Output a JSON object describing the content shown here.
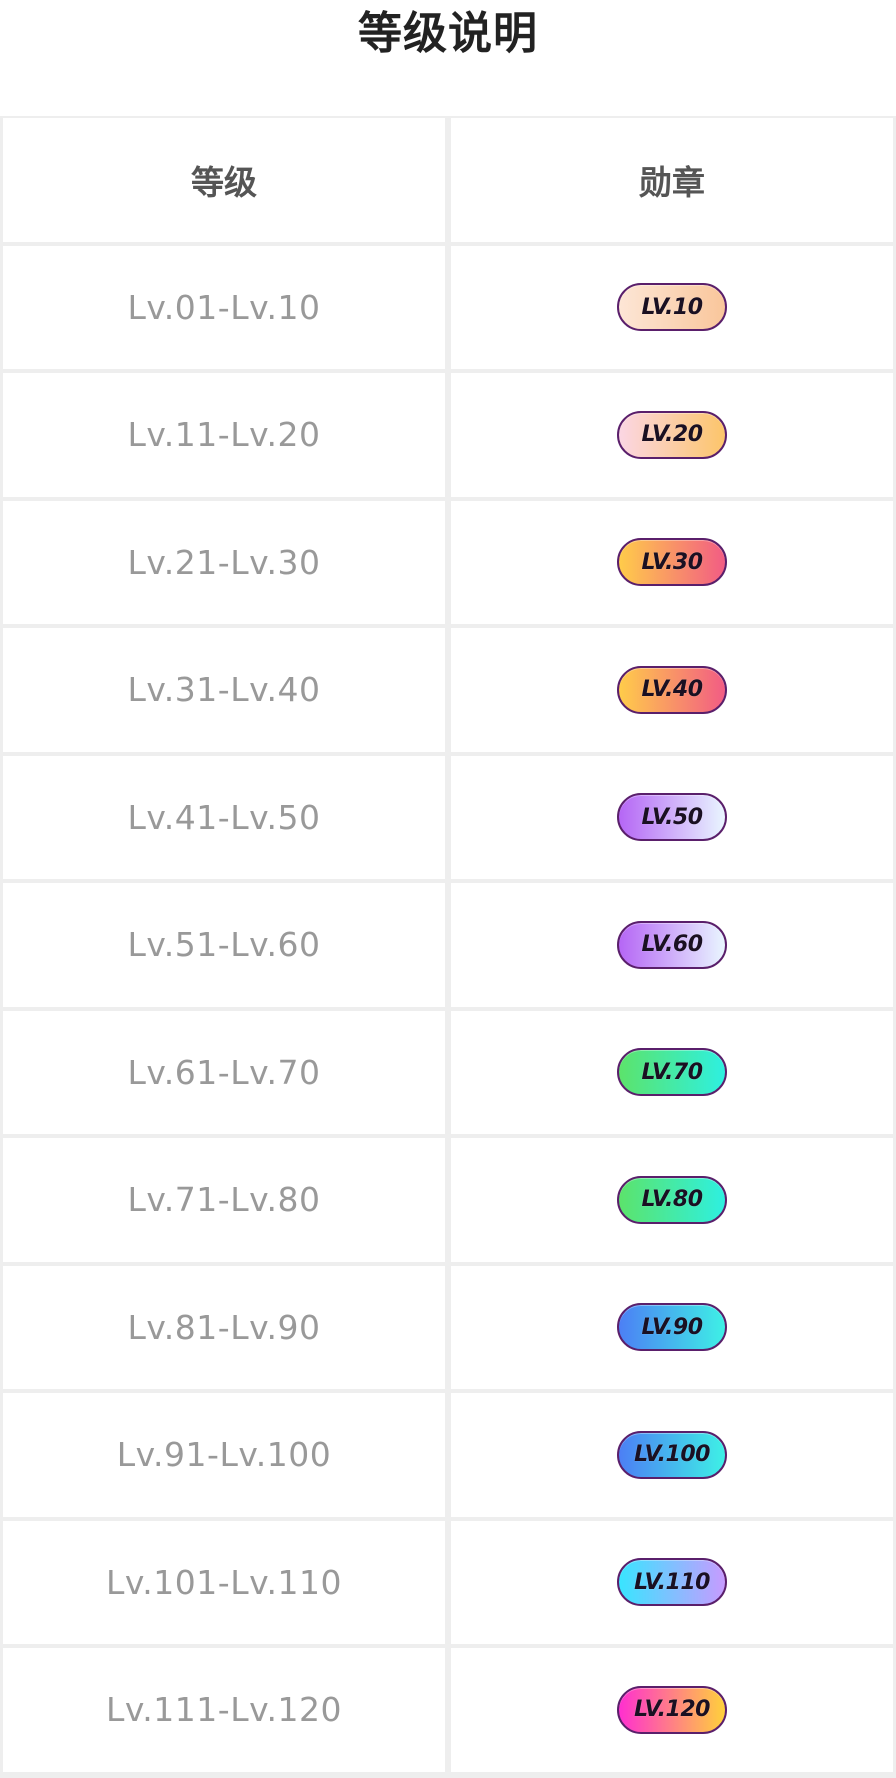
{
  "title": "等级说明",
  "table": {
    "headers": [
      "等级",
      "勋章"
    ],
    "rows": [
      {
        "range": "Lv.01-Lv.10",
        "badge": "LV.10",
        "colors": [
          "#fde6d6",
          "#f9c69b"
        ]
      },
      {
        "range": "Lv.11-Lv.20",
        "badge": "LV.20",
        "colors": [
          "#fbd6e4",
          "#fcc56a"
        ]
      },
      {
        "range": "Lv.21-Lv.30",
        "badge": "LV.30",
        "colors": [
          "#ffcc4a",
          "#f25c84"
        ]
      },
      {
        "range": "Lv.31-Lv.40",
        "badge": "LV.40",
        "colors": [
          "#ffcc4a",
          "#f25c84"
        ]
      },
      {
        "range": "Lv.41-Lv.50",
        "badge": "LV.50",
        "colors": [
          "#b566f5",
          "#e9f6ff"
        ]
      },
      {
        "range": "Lv.51-Lv.60",
        "badge": "LV.60",
        "colors": [
          "#b566f5",
          "#e9f6ff"
        ]
      },
      {
        "range": "Lv.61-Lv.70",
        "badge": "LV.70",
        "colors": [
          "#5ce36b",
          "#2ef0e0"
        ]
      },
      {
        "range": "Lv.71-Lv.80",
        "badge": "LV.80",
        "colors": [
          "#5ce36b",
          "#2ef0e0"
        ]
      },
      {
        "range": "Lv.81-Lv.90",
        "badge": "LV.90",
        "colors": [
          "#4c7ff5",
          "#3ef0e6"
        ]
      },
      {
        "range": "Lv.91-Lv.100",
        "badge": "LV.100",
        "colors": [
          "#4c7ff5",
          "#3ef0e6"
        ]
      },
      {
        "range": "Lv.101-Lv.110",
        "badge": "LV.110",
        "colors": [
          "#39e5ff",
          "#c79bff"
        ]
      },
      {
        "range": "Lv.111-Lv.120",
        "badge": "LV.120",
        "colors": [
          "#ff2fd0",
          "#ffd13b"
        ]
      }
    ]
  }
}
